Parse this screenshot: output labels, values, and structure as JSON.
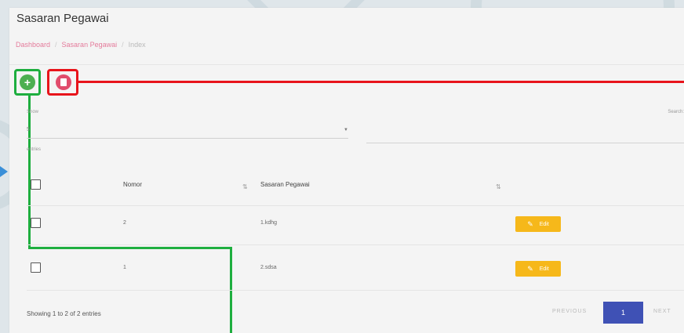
{
  "header": {
    "title": "Sasaran Pegawai",
    "breadcrumb": [
      "Dashboard",
      "Sasaran Pegawai",
      "Index"
    ]
  },
  "toolbar": {
    "add_icon": "plus-icon",
    "delete_icon": "trash-icon"
  },
  "filters": {
    "show_label": "Show",
    "entries_value": "5",
    "entries_label": "entries",
    "search_label": "Search:"
  },
  "table": {
    "columns": [
      "Nomor",
      "Sasaran Pegawai"
    ],
    "rows": [
      {
        "nomor": "2",
        "sasaran": "1.kdhg",
        "action": "Edit"
      },
      {
        "nomor": "1",
        "sasaran": "2.sdsa",
        "action": "Edit"
      }
    ]
  },
  "footer": {
    "info": "Showing 1 to 2 of 2 entries",
    "previous": "PREVIOUS",
    "page": "1",
    "next": "NEXT"
  },
  "colors": {
    "add": "#4caf50",
    "delete": "#e14c6c",
    "edit": "#f6b81a",
    "page_active": "#3f51b5",
    "annotation_green": "#1eae3f",
    "annotation_red": "#e8141b"
  }
}
